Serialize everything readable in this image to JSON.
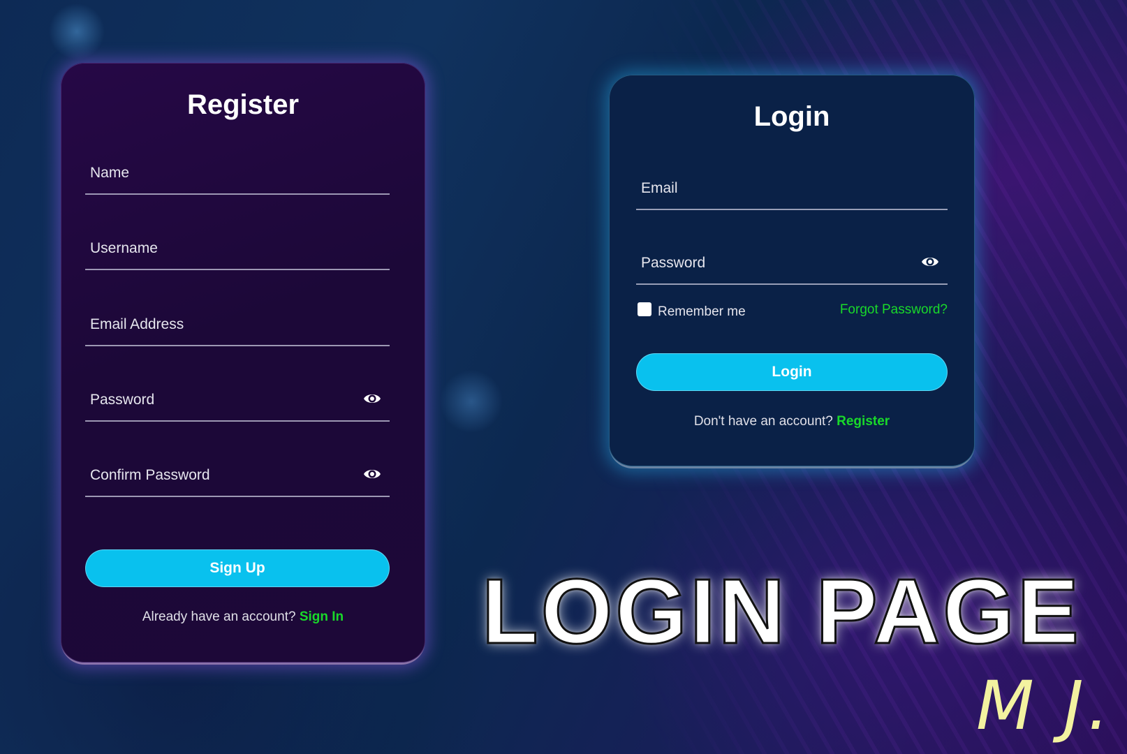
{
  "register": {
    "title": "Register",
    "fields": [
      {
        "label": "Name"
      },
      {
        "label": "Username"
      },
      {
        "label": "Email Address"
      },
      {
        "label": "Password"
      },
      {
        "label": "Confirm Password"
      }
    ],
    "button_label": "Sign Up",
    "footer_text": "Already have an account?",
    "footer_link": "Sign In"
  },
  "login": {
    "title": "Login",
    "email_label": "Email",
    "password_label": "Password",
    "remember_label": "Remember me",
    "remember_checked": false,
    "forgot_link": "Forgot Password?",
    "button_label": "Login",
    "footer_text": "Don't have an account?",
    "footer_link": "Register"
  },
  "headline": "LOGIN PAGE",
  "signature": "M J.",
  "icons": {
    "password_toggle": "eye-icon"
  },
  "colors": {
    "button": "#09c1ee",
    "link": "#19d92a",
    "register_card": "#1c0838",
    "login_card": "#0a2147",
    "signature": "#f3f2a0"
  }
}
